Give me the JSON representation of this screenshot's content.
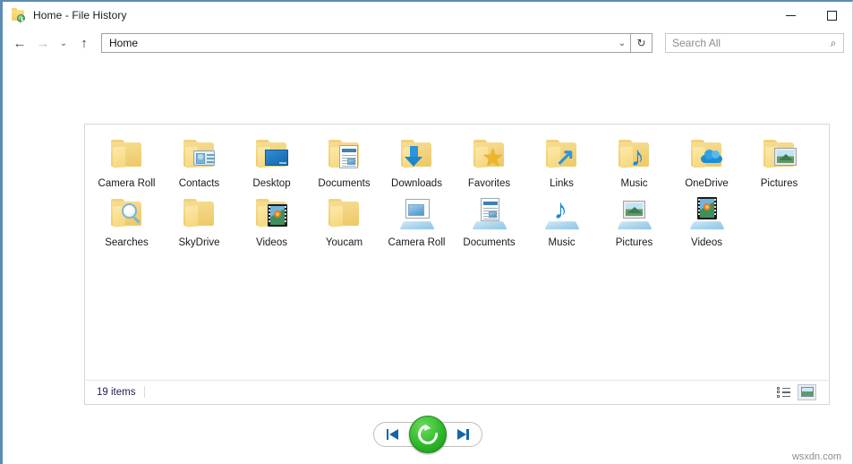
{
  "window": {
    "title": "Home - File History",
    "icon": "file-history-folder-icon",
    "controls": {
      "minimize": "—",
      "maximize": "☐"
    }
  },
  "toolbar": {
    "back": "←",
    "forward": "→",
    "recent": "⌄",
    "up": "↑",
    "address_value": "Home",
    "address_chevron": "⌄",
    "refresh": "↻",
    "search_placeholder": "Search All",
    "search_icon": "⌕"
  },
  "content": {
    "items": [
      {
        "label": "Camera Roll",
        "icon": "folder-plain",
        "kind": "folder"
      },
      {
        "label": "Contacts",
        "icon": "folder-contacts",
        "kind": "folder"
      },
      {
        "label": "Desktop",
        "icon": "folder-desktop",
        "kind": "folder"
      },
      {
        "label": "Documents",
        "icon": "folder-documents",
        "kind": "folder"
      },
      {
        "label": "Downloads",
        "icon": "folder-downloads",
        "kind": "folder"
      },
      {
        "label": "Favorites",
        "icon": "folder-favorites",
        "kind": "folder"
      },
      {
        "label": "Links",
        "icon": "folder-links",
        "kind": "folder"
      },
      {
        "label": "Music",
        "icon": "folder-music",
        "kind": "folder"
      },
      {
        "label": "OneDrive",
        "icon": "folder-onedrive",
        "kind": "folder"
      },
      {
        "label": "Pictures",
        "icon": "folder-pictures",
        "kind": "folder"
      },
      {
        "label": "Searches",
        "icon": "folder-searches",
        "kind": "folder"
      },
      {
        "label": "SkyDrive",
        "icon": "folder-plain",
        "kind": "folder"
      },
      {
        "label": "Videos",
        "icon": "folder-videos",
        "kind": "folder"
      },
      {
        "label": "Youcam",
        "icon": "folder-plain",
        "kind": "folder"
      },
      {
        "label": "Camera Roll",
        "icon": "library-camera-roll",
        "kind": "library"
      },
      {
        "label": "Documents",
        "icon": "library-documents",
        "kind": "library"
      },
      {
        "label": "Music",
        "icon": "library-music",
        "kind": "library"
      },
      {
        "label": "Pictures",
        "icon": "library-pictures",
        "kind": "library"
      },
      {
        "label": "Videos",
        "icon": "library-videos",
        "kind": "library"
      }
    ]
  },
  "statusbar": {
    "items_count": "19 items",
    "view_details_icon": "details-view-icon",
    "view_thumbnails_icon": "thumbnails-view-icon"
  },
  "restore_controls": {
    "previous": "previous-version-button",
    "restore": "restore-button",
    "next": "next-version-button"
  },
  "watermark": "wsxdn.com",
  "colors": {
    "accent_blue": "#5a8db3",
    "folder_yellow": "#f3cc62",
    "restore_green": "#2fb82a",
    "link_blue": "#1565a8"
  }
}
